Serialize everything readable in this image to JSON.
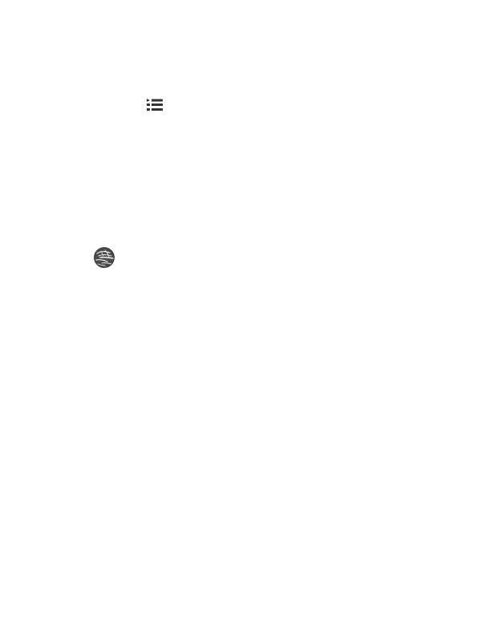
{
  "icons": {
    "list": {
      "name": "list-icon",
      "color": "#333333"
    },
    "globe": {
      "name": "globe-icon",
      "color": "#4a4a4a",
      "highlight": "#e8e8e8"
    }
  }
}
